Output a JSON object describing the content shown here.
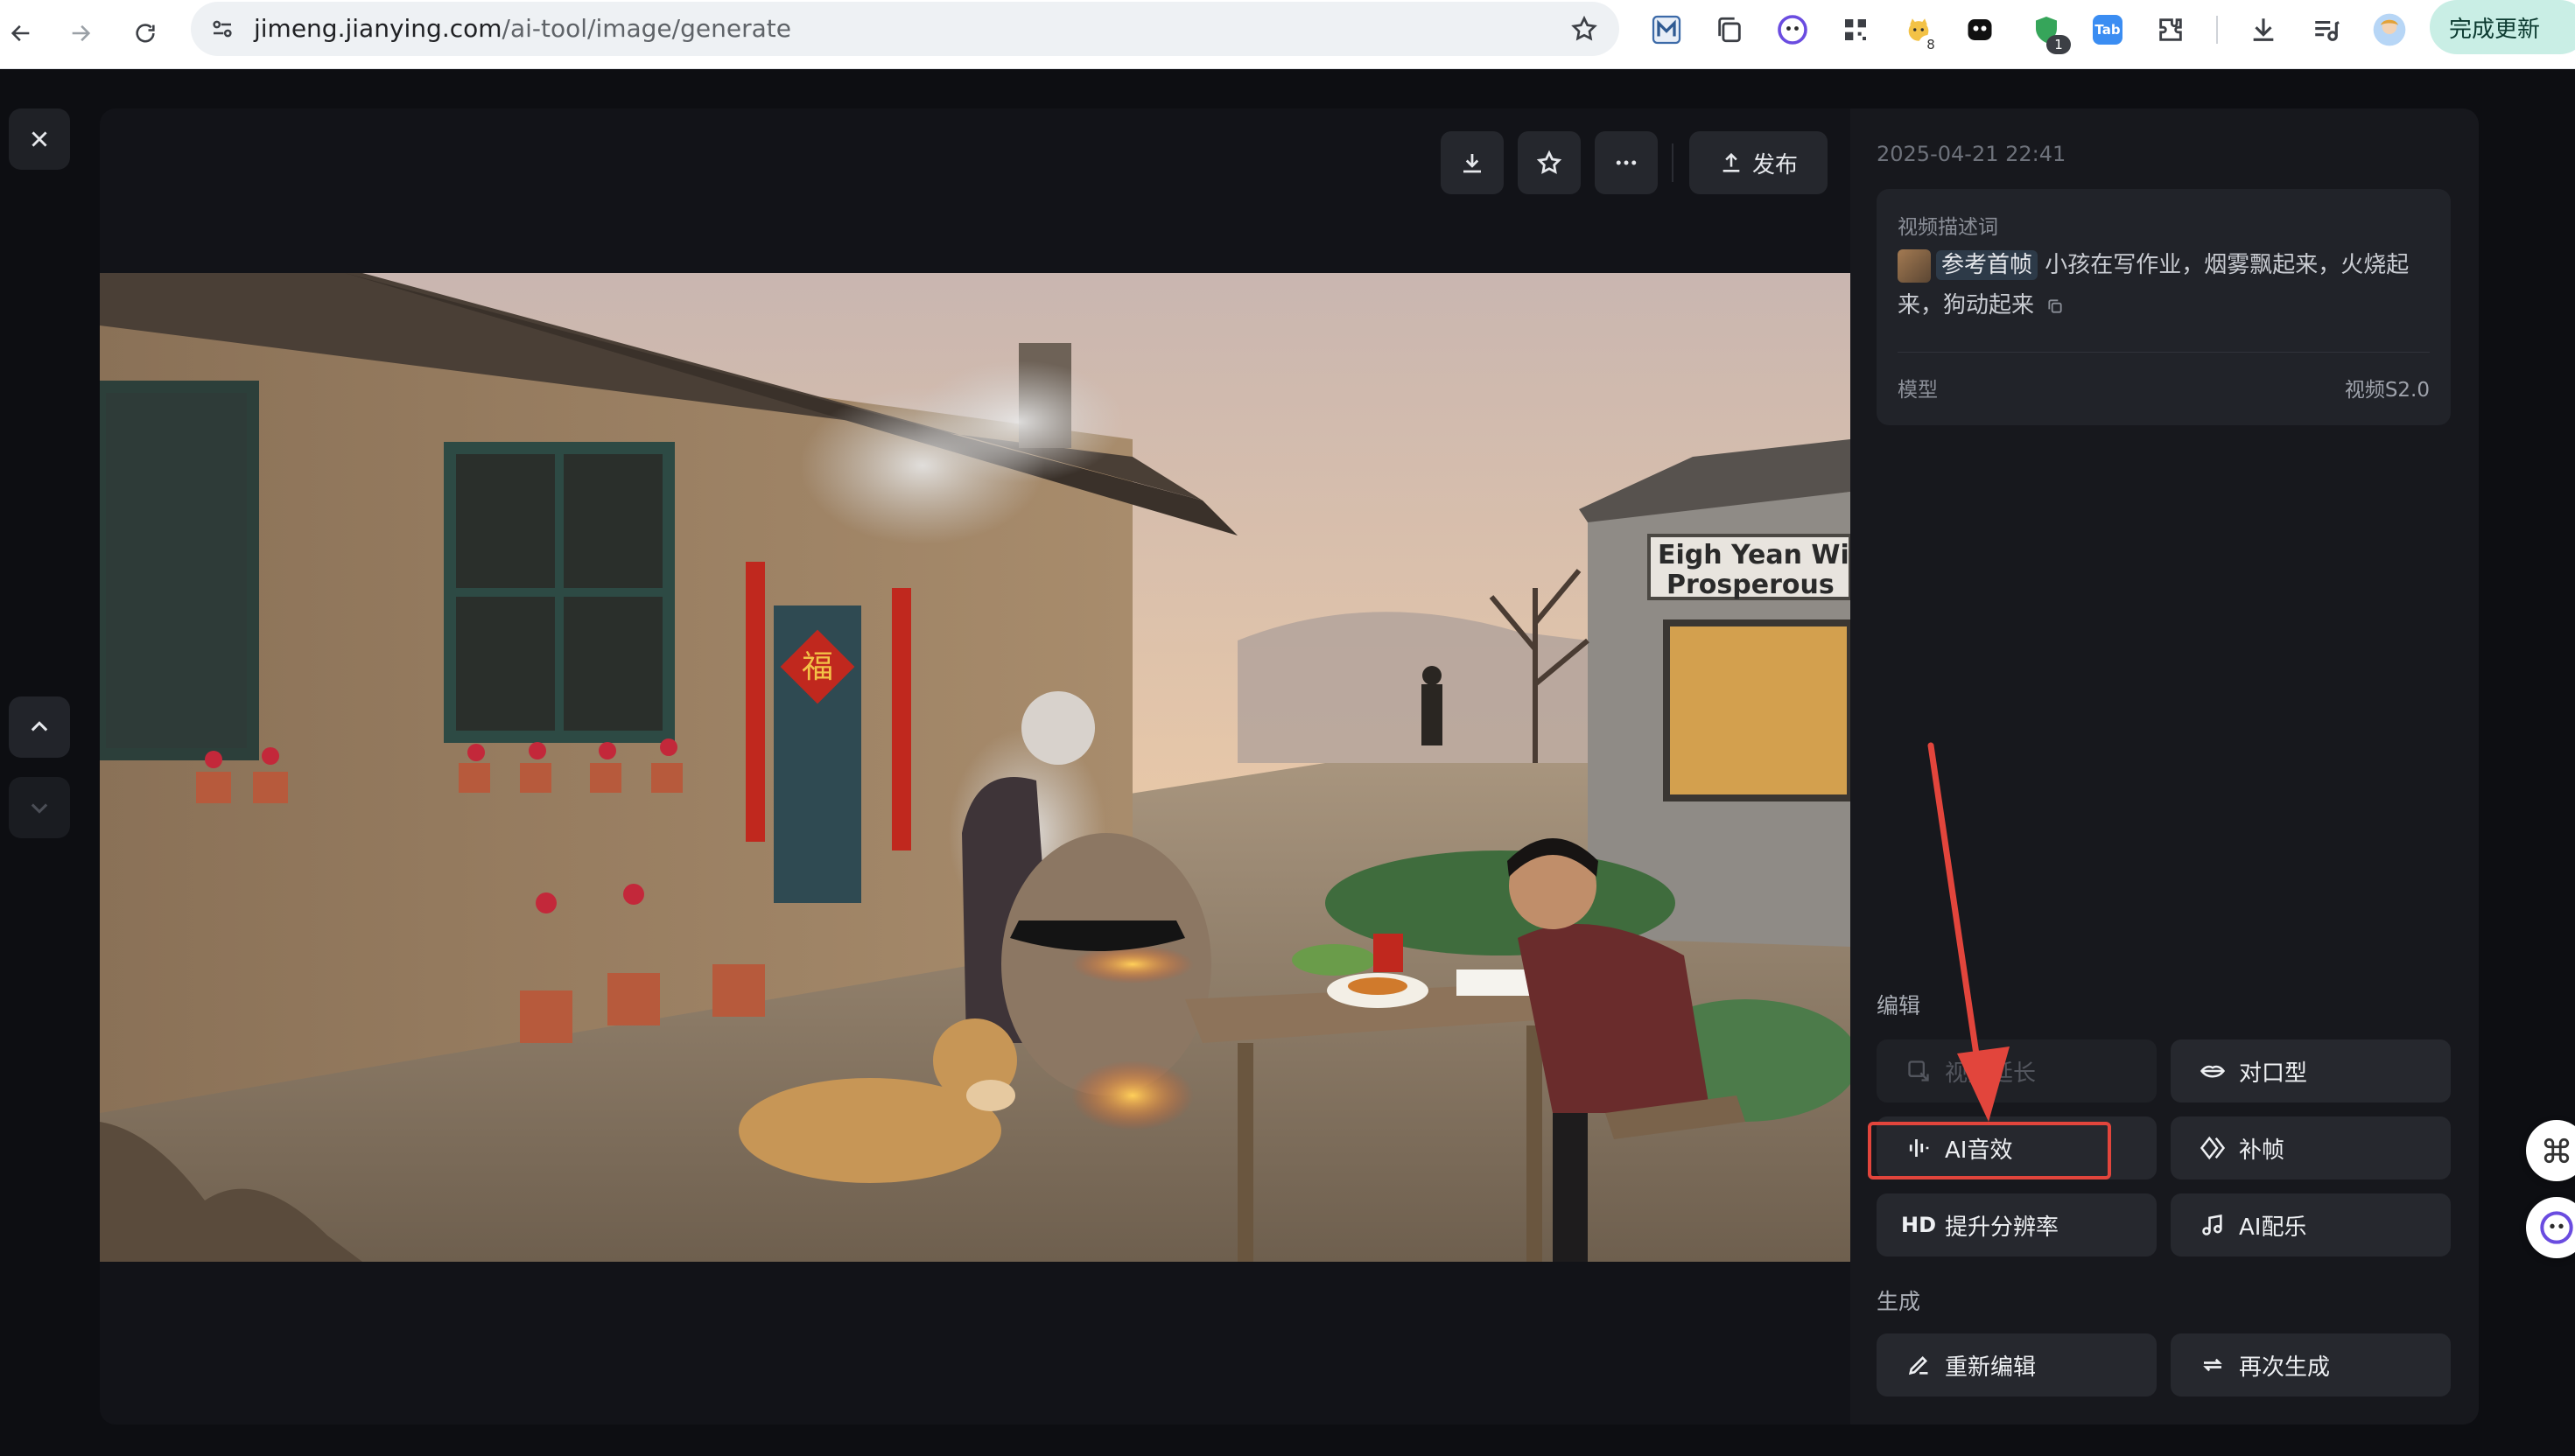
{
  "browser": {
    "url_host": "jimeng.jianying.com",
    "url_path": "/ai-tool/image/generate",
    "update_label": "完成更新",
    "ext_badges": {
      "ext5": "8",
      "ext8": "1"
    },
    "ext_labels": {
      "tab": "Tab"
    }
  },
  "toolbar": {
    "publish_label": "发布"
  },
  "panel": {
    "timestamp": "2025-04-21 22:41",
    "desc_label": "视频描述词",
    "ref_tag": "参考首帧",
    "prompt": "小孩在写作业，烟雾飘起来，火烧起来，狗动起来",
    "model_label": "模型",
    "model_value": "视频S2.0",
    "edit_title": "编辑",
    "generate_title": "生成",
    "actions": {
      "extend": "视频延长",
      "lipsync": "对口型",
      "ai_sfx": "AI音效",
      "interp": "补帧",
      "hd_badge": "HD",
      "upscale": "提升分辨率",
      "ai_music": "AI配乐",
      "reedit": "重新编辑",
      "regenerate": "再次生成"
    }
  },
  "scene": {
    "shop_sign_line1": "Eigh Yean Wi",
    "shop_sign_line2": "Prosperous",
    "door_char": "福"
  },
  "colors": {
    "accent_red": "#e2453c",
    "update_btn": "#c9eee5",
    "panel_bg": "#17181d",
    "button_bg": "#26282e"
  }
}
